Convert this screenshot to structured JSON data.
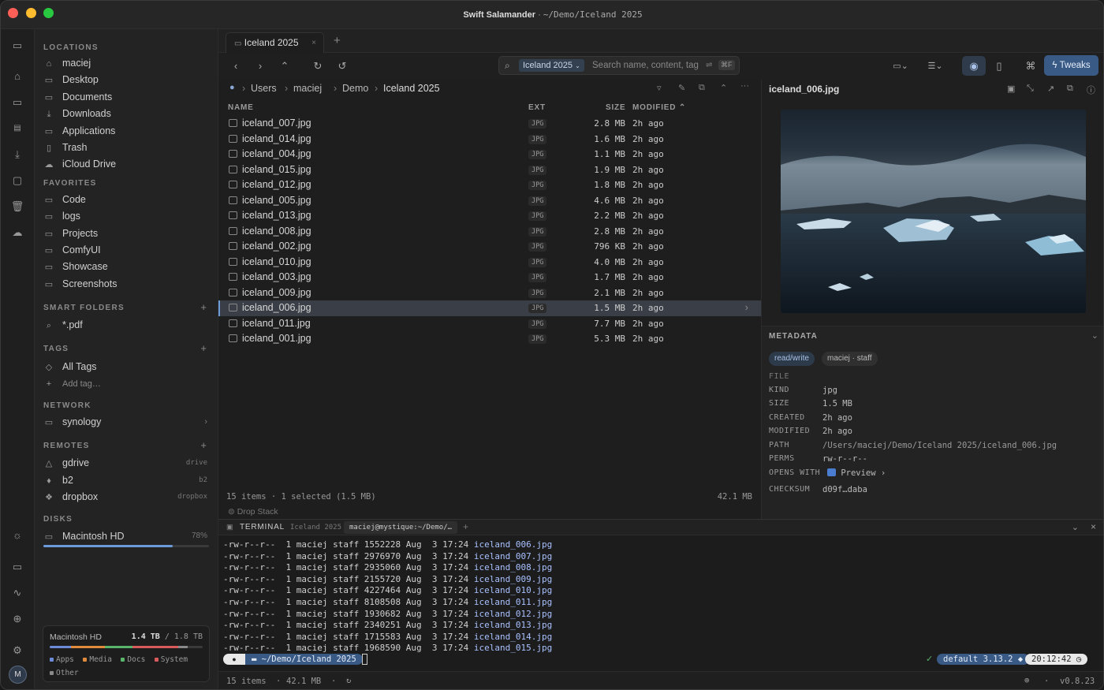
{
  "window": {
    "app_name": "Swift Salamander",
    "path": "~/Demo/Iceland 2025"
  },
  "sidebar": {
    "locations_label": "LOCATIONS",
    "locations": [
      "maciej",
      "Desktop",
      "Documents",
      "Downloads",
      "Applications",
      "Trash",
      "iCloud Drive"
    ],
    "favorites_label": "FAVORITES",
    "favorites": [
      "Code",
      "logs",
      "Projects",
      "ComfyUI",
      "Showcase",
      "Screenshots"
    ],
    "smart_label": "SMART FOLDERS",
    "smart": [
      "*.pdf"
    ],
    "tags_label": "TAGS",
    "tags_all": "All Tags",
    "tags_add": "Add tag…",
    "network_label": "NETWORK",
    "network": [
      "synology"
    ],
    "remotes_label": "REMOTES",
    "remotes": [
      {
        "name": "gdrive",
        "type": "drive"
      },
      {
        "name": "b2",
        "type": "b2"
      },
      {
        "name": "dropbox",
        "type": "dropbox"
      }
    ],
    "disks_label": "DISKS",
    "disk": {
      "name": "Macintosh HD",
      "pct_label": "78%",
      "fill": 0.78
    },
    "disk_card": {
      "name": "Macintosh HD",
      "used": "1.4 TB",
      "total": "/ 1.8 TB",
      "legend": [
        "Apps",
        "Media",
        "Docs",
        "System",
        "Other"
      ]
    }
  },
  "tabs": [
    {
      "label": "Iceland 2025"
    }
  ],
  "search": {
    "scope": "Iceland 2025",
    "placeholder": "Search name, content, tag",
    "shortcut": "⌘F"
  },
  "toolbar": {
    "tweaks": "Tweaks"
  },
  "breadcrumb": [
    "Users",
    "maciej",
    "Demo",
    "Iceland 2025"
  ],
  "columns": {
    "name": "NAME",
    "ext": "EXT",
    "size": "SIZE",
    "modified": "MODIFIED"
  },
  "files": [
    {
      "name": "iceland_007.jpg",
      "ext": "JPG",
      "size": "2.8 MB",
      "mod": "2h ago"
    },
    {
      "name": "iceland_014.jpg",
      "ext": "JPG",
      "size": "1.6 MB",
      "mod": "2h ago"
    },
    {
      "name": "iceland_004.jpg",
      "ext": "JPG",
      "size": "1.1 MB",
      "mod": "2h ago"
    },
    {
      "name": "iceland_015.jpg",
      "ext": "JPG",
      "size": "1.9 MB",
      "mod": "2h ago"
    },
    {
      "name": "iceland_012.jpg",
      "ext": "JPG",
      "size": "1.8 MB",
      "mod": "2h ago"
    },
    {
      "name": "iceland_005.jpg",
      "ext": "JPG",
      "size": "4.6 MB",
      "mod": "2h ago"
    },
    {
      "name": "iceland_013.jpg",
      "ext": "JPG",
      "size": "2.2 MB",
      "mod": "2h ago"
    },
    {
      "name": "iceland_008.jpg",
      "ext": "JPG",
      "size": "2.8 MB",
      "mod": "2h ago"
    },
    {
      "name": "iceland_002.jpg",
      "ext": "JPG",
      "size": "796 KB",
      "mod": "2h ago"
    },
    {
      "name": "iceland_010.jpg",
      "ext": "JPG",
      "size": "4.0 MB",
      "mod": "2h ago"
    },
    {
      "name": "iceland_003.jpg",
      "ext": "JPG",
      "size": "1.7 MB",
      "mod": "2h ago"
    },
    {
      "name": "iceland_009.jpg",
      "ext": "JPG",
      "size": "2.1 MB",
      "mod": "2h ago"
    },
    {
      "name": "iceland_006.jpg",
      "ext": "JPG",
      "size": "1.5 MB",
      "mod": "2h ago",
      "selected": true
    },
    {
      "name": "iceland_011.jpg",
      "ext": "JPG",
      "size": "7.7 MB",
      "mod": "2h ago"
    },
    {
      "name": "iceland_001.jpg",
      "ext": "JPG",
      "size": "5.3 MB",
      "mod": "2h ago"
    }
  ],
  "status": {
    "left": "15 items · 1 selected (1.5 MB)",
    "right": "42.1 MB",
    "drop": "Drop Stack"
  },
  "preview": {
    "title": "iceland_006.jpg",
    "metadata_label": "METADATA",
    "chips": [
      "read/write",
      "maciej · staff"
    ],
    "file_label": "FILE",
    "rows": [
      {
        "k": "KIND",
        "v": "jpg"
      },
      {
        "k": "SIZE",
        "v": "1.5 MB"
      },
      {
        "k": "CREATED",
        "v": "2h ago"
      },
      {
        "k": "MODIFIED",
        "v": "2h ago"
      },
      {
        "k": "PATH",
        "v": "/Users/maciej/Demo/Iceland 2025/iceland_006.jpg"
      },
      {
        "k": "PERMS",
        "v": "rw-r--r--"
      },
      {
        "k": "OPENS WITH",
        "v": "Preview"
      },
      {
        "k": "CHECKSUM",
        "v": "d09f…daba"
      }
    ]
  },
  "terminal": {
    "label": "TERMINAL",
    "tab1": "Iceland 2025",
    "tab2": "maciej@mystique:~/Demo/…",
    "lines": [
      {
        "p": "-rw-r--r--  1 maciej staff 1552228 Aug  3 17:24 ",
        "f": "iceland_006.jpg"
      },
      {
        "p": "-rw-r--r--  1 maciej staff 2976970 Aug  3 17:24 ",
        "f": "iceland_007.jpg"
      },
      {
        "p": "-rw-r--r--  1 maciej staff 2935060 Aug  3 17:24 ",
        "f": "iceland_008.jpg"
      },
      {
        "p": "-rw-r--r--  1 maciej staff 2155720 Aug  3 17:24 ",
        "f": "iceland_009.jpg"
      },
      {
        "p": "-rw-r--r--  1 maciej staff 4227464 Aug  3 17:24 ",
        "f": "iceland_010.jpg"
      },
      {
        "p": "-rw-r--r--  1 maciej staff 8108508 Aug  3 17:24 ",
        "f": "iceland_011.jpg"
      },
      {
        "p": "-rw-r--r--  1 maciej staff 1930682 Aug  3 17:24 ",
        "f": "iceland_012.jpg"
      },
      {
        "p": "-rw-r--r--  1 maciej staff 2340251 Aug  3 17:24 ",
        "f": "iceland_013.jpg"
      },
      {
        "p": "-rw-r--r--  1 maciej staff 1715583 Aug  3 17:24 ",
        "f": "iceland_014.jpg"
      },
      {
        "p": "-rw-r--r--  1 maciej staff 1968590 Aug  3 17:24 ",
        "f": "iceland_015.jpg"
      }
    ],
    "prompt_path": "~/Demo/Iceland 2025",
    "env": "default 3.13.2",
    "clock": "20:12:42"
  },
  "footer": {
    "items": "15 items",
    "size": "42.1 MB",
    "version": "v0.8.23"
  },
  "user": {
    "initial": "M"
  }
}
